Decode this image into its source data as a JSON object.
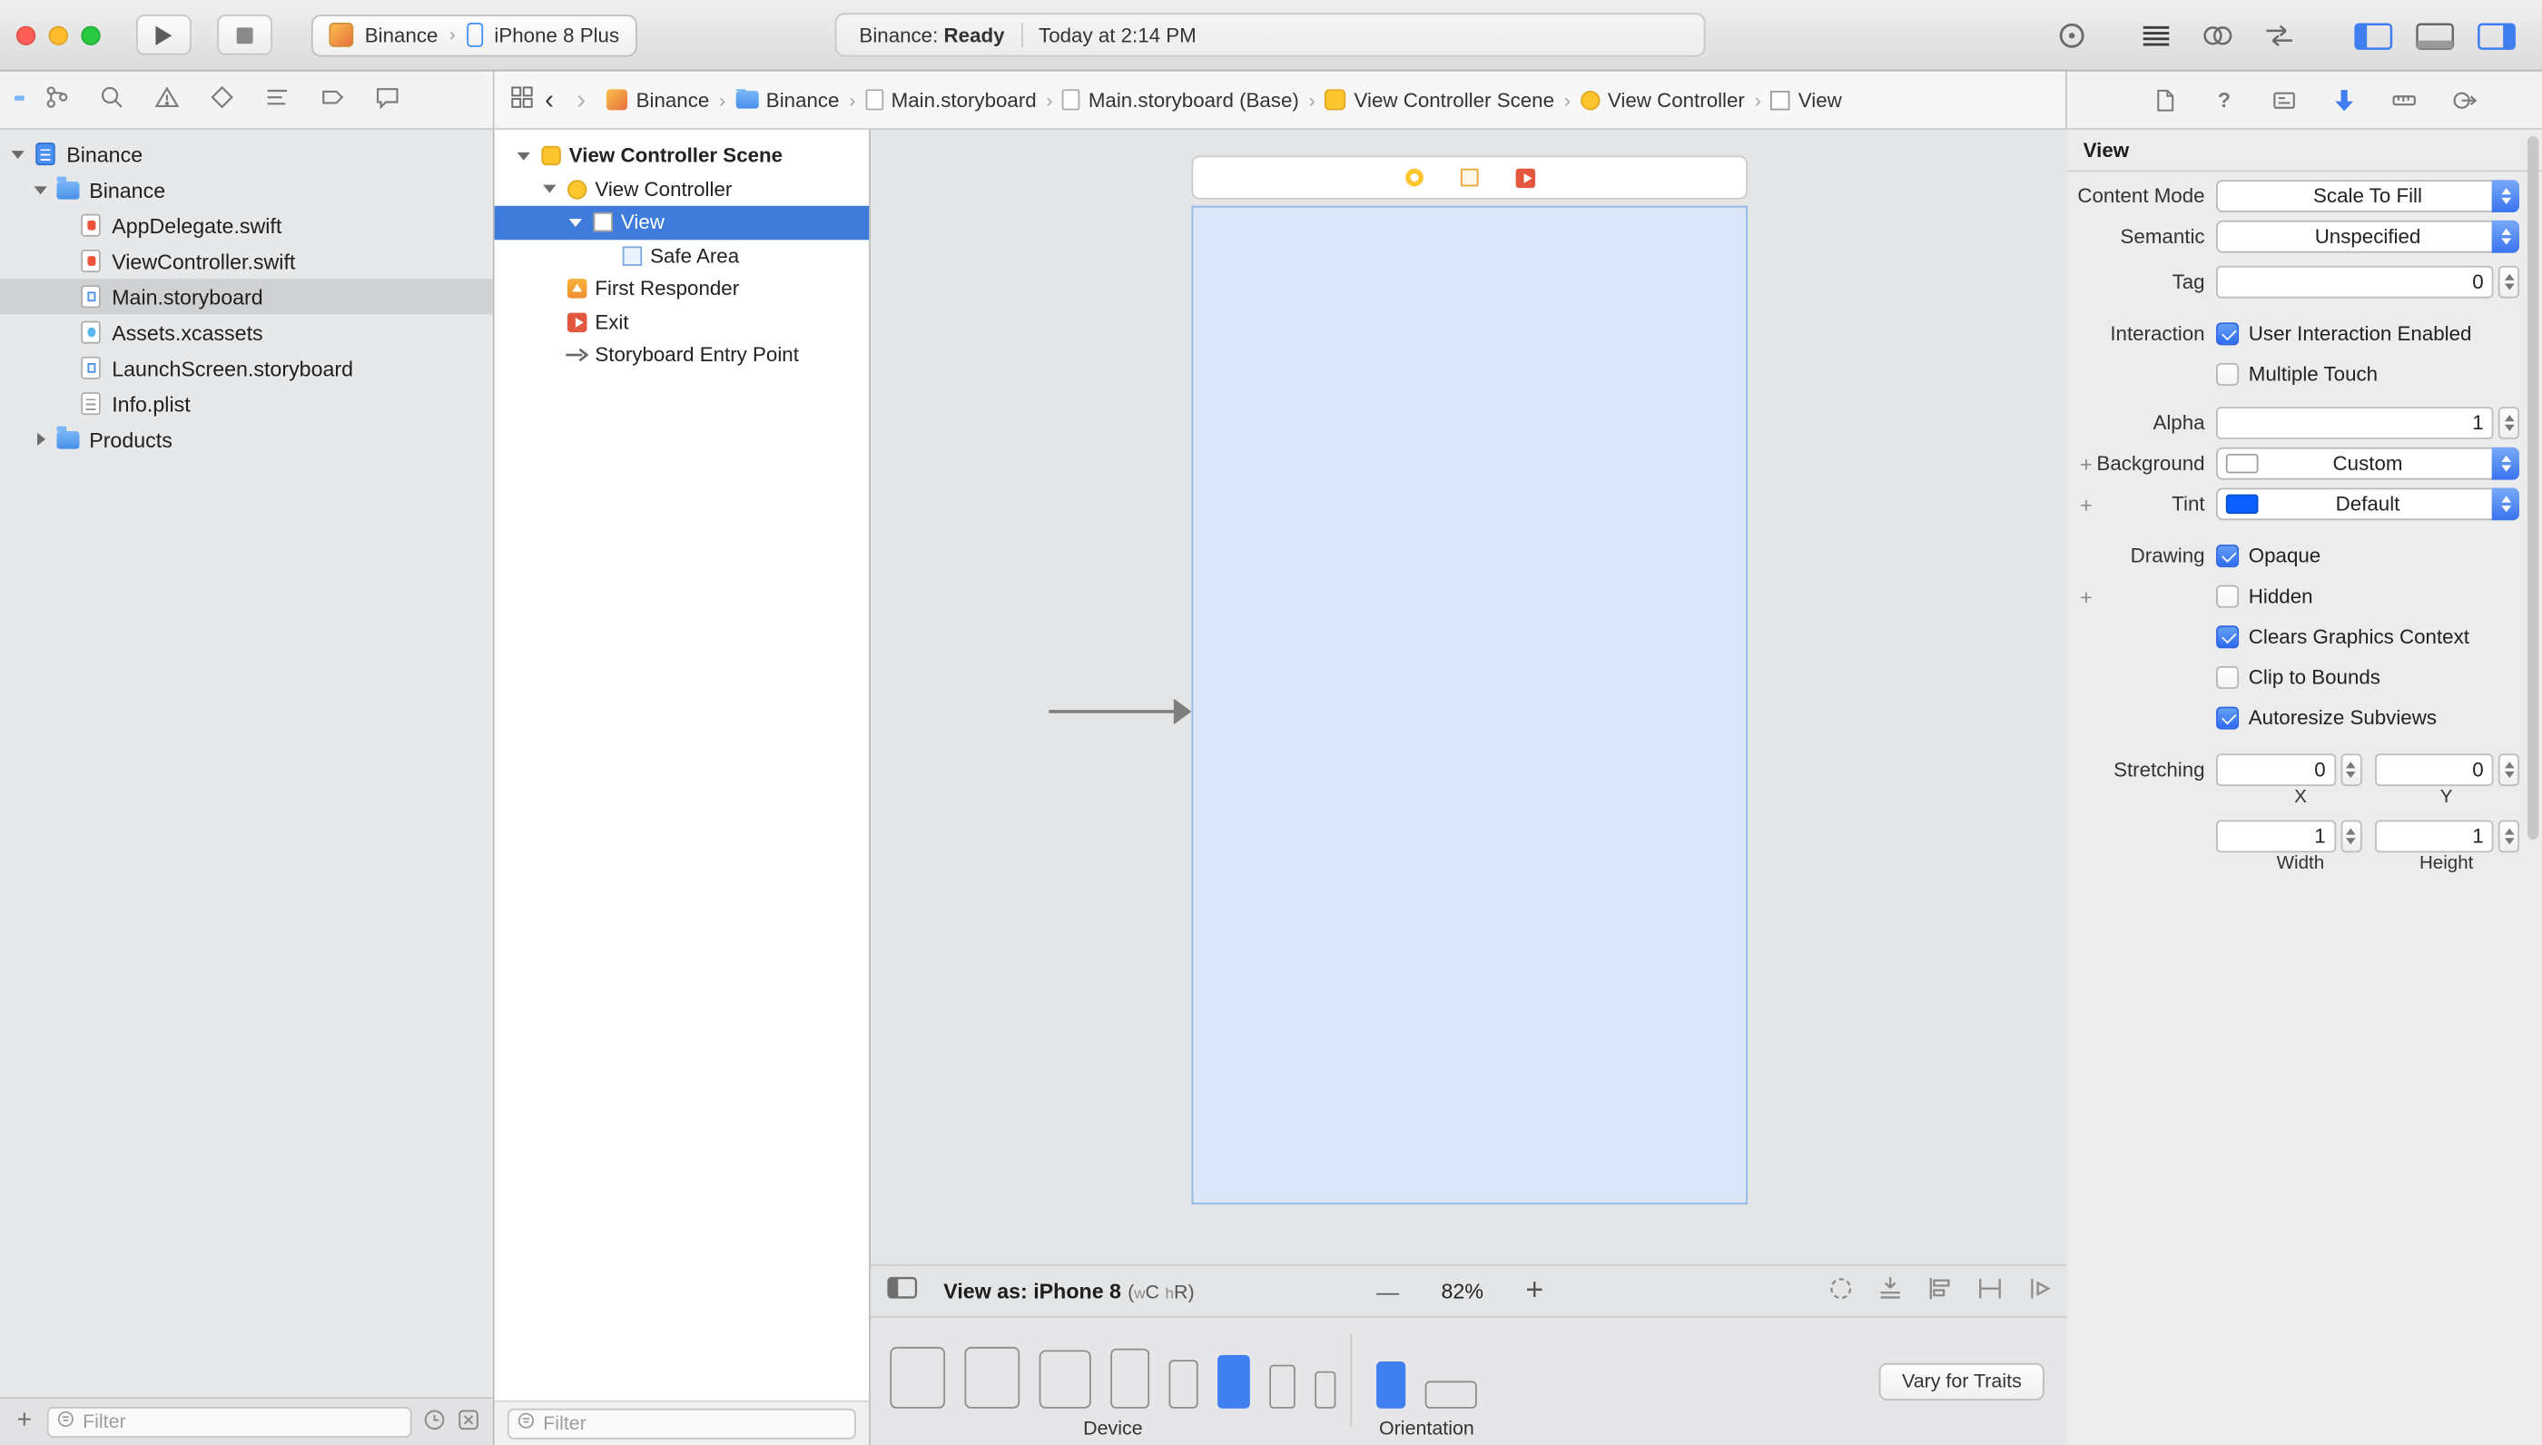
{
  "toolbar": {
    "scheme_project": "Binance",
    "scheme_device": "iPhone 8 Plus",
    "status_project": "Binance:",
    "status_state": "Ready",
    "status_time": "Today at 2:14 PM"
  },
  "jumpbar": {
    "crumbs": [
      {
        "label": "Binance"
      },
      {
        "label": "Binance"
      },
      {
        "label": "Main.storyboard"
      },
      {
        "label": "Main.storyboard (Base)"
      },
      {
        "label": "View Controller Scene"
      },
      {
        "label": "View Controller"
      },
      {
        "label": "View"
      }
    ]
  },
  "navigator": {
    "filter_placeholder": "Filter",
    "items": [
      {
        "label": "Binance",
        "type": "project",
        "selected": false
      },
      {
        "label": "Binance",
        "type": "folder",
        "selected": false
      },
      {
        "label": "AppDelegate.swift",
        "type": "swift",
        "selected": false
      },
      {
        "label": "ViewController.swift",
        "type": "swift",
        "selected": false
      },
      {
        "label": "Main.storyboard",
        "type": "storyboard",
        "selected": true
      },
      {
        "label": "Assets.xcassets",
        "type": "assets",
        "selected": false
      },
      {
        "label": "LaunchScreen.storyboard",
        "type": "storyboard",
        "selected": false
      },
      {
        "label": "Info.plist",
        "type": "plist",
        "selected": false
      },
      {
        "label": "Products",
        "type": "folder",
        "selected": false
      }
    ]
  },
  "outline": {
    "filter_placeholder": "Filter",
    "items": [
      {
        "label": "View Controller Scene",
        "selected": false
      },
      {
        "label": "View Controller",
        "selected": false
      },
      {
        "label": "View",
        "selected": true
      },
      {
        "label": "Safe Area",
        "selected": false
      },
      {
        "label": "First Responder",
        "selected": false
      },
      {
        "label": "Exit",
        "selected": false
      },
      {
        "label": "Storyboard Entry Point",
        "selected": false
      }
    ]
  },
  "canvas": {
    "view_as": "View as: iPhone 8",
    "traits_open": "(",
    "trait_w": "w",
    "trait_wc": "C",
    "trait_h": "h",
    "trait_hr": "R",
    "traits_close": ")",
    "zoom_level": "82%",
    "device_label": "Device",
    "orientation_label": "Orientation",
    "vary_button": "Vary for Traits"
  },
  "inspector": {
    "section_title": "View",
    "content_mode_label": "Content Mode",
    "content_mode_value": "Scale To Fill",
    "semantic_label": "Semantic",
    "semantic_value": "Unspecified",
    "tag_label": "Tag",
    "tag_value": "0",
    "interaction_label": "Interaction",
    "interaction_cb1": "User Interaction Enabled",
    "interaction_cb1_checked": true,
    "interaction_cb2": "Multiple Touch",
    "interaction_cb2_checked": false,
    "alpha_label": "Alpha",
    "alpha_value": "1",
    "background_label": "Background",
    "background_value": "Custom",
    "tint_label": "Tint",
    "tint_value": "Default",
    "drawing_label": "Drawing",
    "drawing_cb1": "Opaque",
    "drawing_cb1_checked": true,
    "drawing_cb2": "Hidden",
    "drawing_cb2_checked": false,
    "drawing_cb3": "Clears Graphics Context",
    "drawing_cb3_checked": true,
    "drawing_cb4": "Clip to Bounds",
    "drawing_cb4_checked": false,
    "drawing_cb5": "Autoresize Subviews",
    "drawing_cb5_checked": true,
    "stretching_label": "Stretching",
    "stretch_x_value": "0",
    "stretch_x_label": "X",
    "stretch_y_value": "0",
    "stretch_y_label": "Y",
    "stretch_w_value": "1",
    "stretch_w_label": "Width",
    "stretch_h_value": "1",
    "stretch_h_label": "Height"
  },
  "colors": {
    "accent_blue": "#3f7ef0",
    "selection_blue": "#3e7bdb",
    "tint_swatch": "#0a60ff",
    "scene_fill": "#dbe7f8",
    "xcode_yellow": "#fdc62f",
    "exit_orange": "#e2573e"
  }
}
